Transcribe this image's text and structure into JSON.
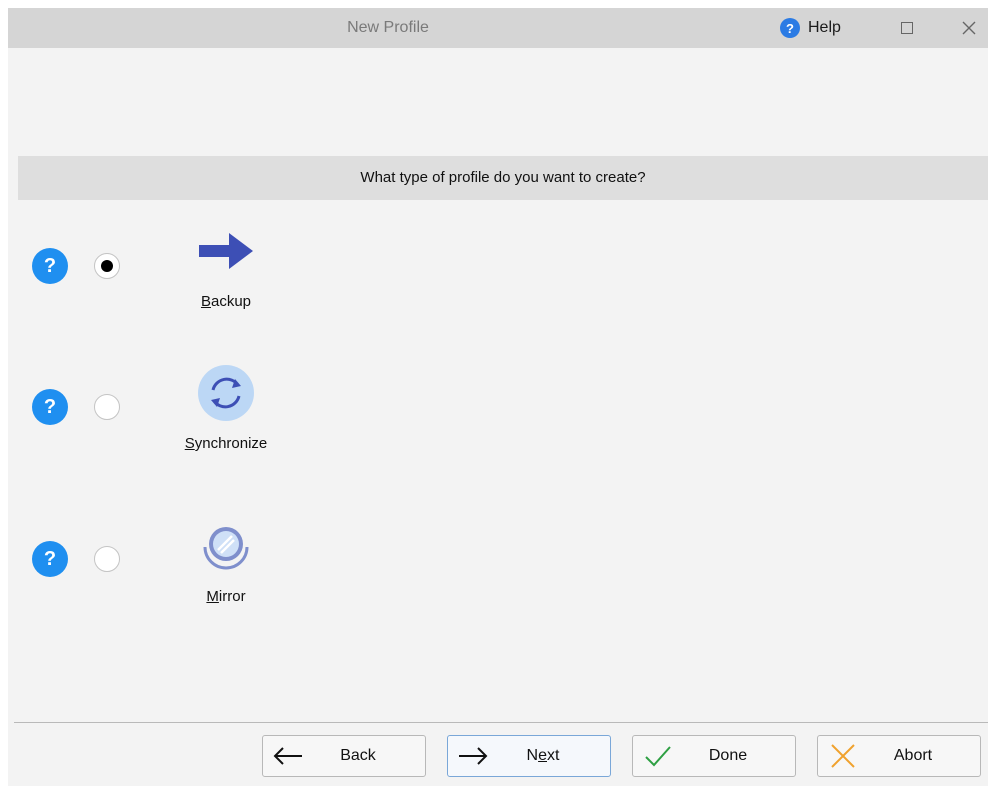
{
  "window": {
    "title": "New Profile",
    "help_label": "Help",
    "help_icon_glyph": "?"
  },
  "question": "What type of profile do you want to create?",
  "options": [
    {
      "label_mnemonic": "B",
      "label_rest": "ackup",
      "selected": true,
      "icon": "right-arrow-icon"
    },
    {
      "label_mnemonic": "S",
      "label_rest": "ynchronize",
      "selected": false,
      "icon": "sync-icon"
    },
    {
      "label_mnemonic": "M",
      "label_rest": "irror",
      "selected": false,
      "icon": "mirror-icon"
    }
  ],
  "option_help_glyph": "?",
  "buttons": {
    "back": "Back",
    "next_pre": "N",
    "next_mnemonic": "e",
    "next_post": "xt",
    "done": "Done",
    "abort": "Abort"
  },
  "colors": {
    "accent_blue": "#1f8ff0",
    "arrow_blue": "#3d4fb5",
    "done_green": "#2ea043",
    "abort_orange": "#f0a22e"
  }
}
